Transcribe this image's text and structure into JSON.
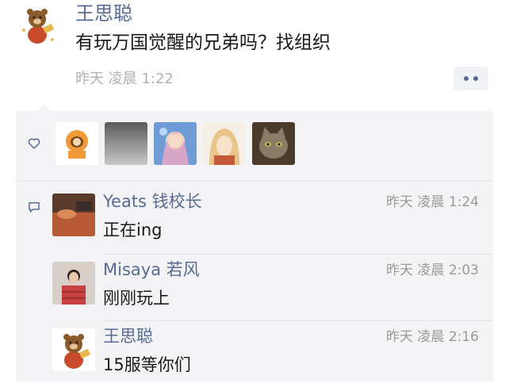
{
  "post": {
    "author": "王思聪",
    "content": "有玩万国觉醒的兄弟吗？找组织",
    "time": "昨天 凌晨 1:22",
    "avatar_icon": "bear-avatar-icon",
    "more_icon": "more-dots-icon"
  },
  "likes": {
    "icon": "heart-icon",
    "avatars": [
      {
        "name": "kenny-avatar",
        "color": "#f29a38"
      },
      {
        "name": "gray-photo-avatar",
        "color": "#9c9c9c"
      },
      {
        "name": "anime-girl-avatar",
        "color": "#7fa8d8"
      },
      {
        "name": "anime-blonde-avatar",
        "color": "#e8d0a8"
      },
      {
        "name": "cat-avatar",
        "color": "#7a6a58"
      }
    ]
  },
  "comments": {
    "icon": "comment-icon",
    "items": [
      {
        "name": "Yeats 钱校长",
        "time": "昨天 凌晨 1:24",
        "text": "正在ing",
        "avatar_color": "#b85a36"
      },
      {
        "name": "Misaya 若风",
        "time": "昨天 凌晨 2:03",
        "text": "刚刚玩上",
        "avatar_color": "#c54040"
      },
      {
        "name": "王思聪",
        "time": "昨天 凌晨 2:16",
        "text": "15服等你们",
        "avatar_color": "#8b5a2b"
      }
    ]
  },
  "colors": {
    "name_blue": "#576b95",
    "panel_bg": "#f3f3f5",
    "text": "#1a1a1a",
    "muted": "#9a9a9a"
  }
}
